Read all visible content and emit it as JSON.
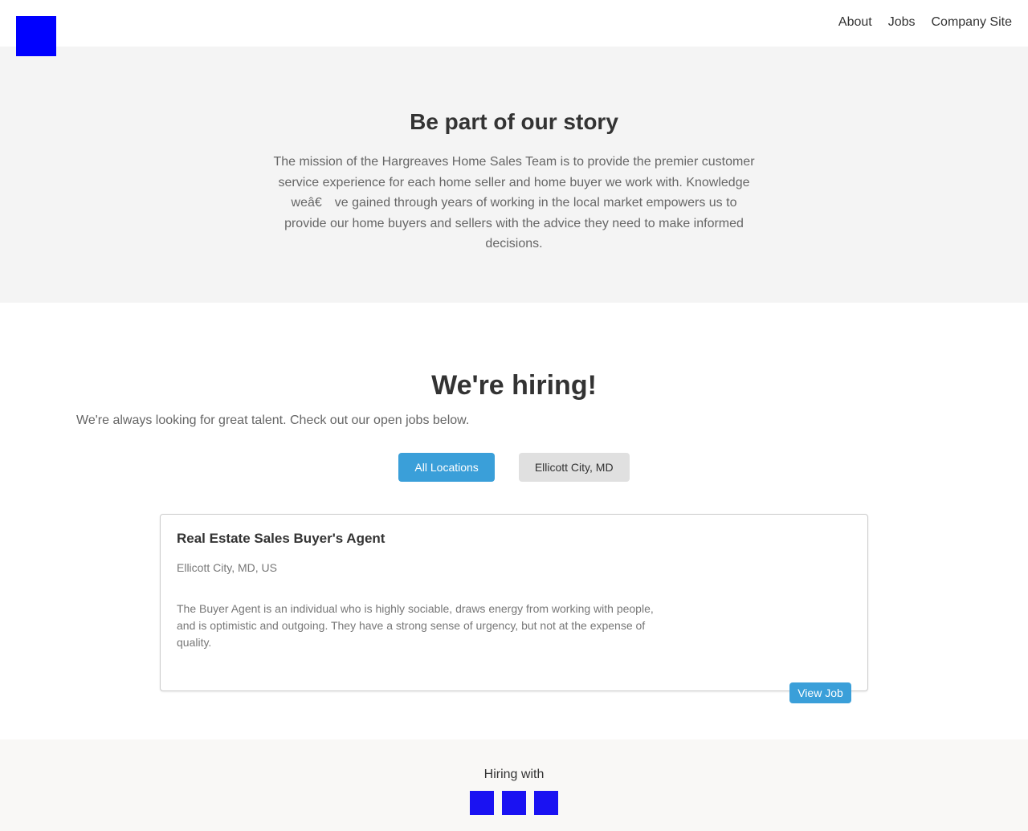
{
  "colors": {
    "logo": "#0000ff",
    "accent": "#3a9fd9",
    "hero_bg": "#f4f4f4",
    "footer_icon": "#1a12f2"
  },
  "header": {
    "nav": [
      "About",
      "Jobs",
      "Company Site"
    ]
  },
  "hero": {
    "title": "Be part of our story",
    "body": "The mission of the Hargreaves Home Sales Team is to provide the premier customer service experience for each home seller and home buyer we work with. Knowledge weâ€ ve gained through years of working in the local market empowers us to provide our home buyers and sellers with the advice they need to make informed decisions."
  },
  "hiring": {
    "title": "We're hiring!",
    "subtitle": "We're always looking for great talent. Check out our open jobs below.",
    "filters": [
      "All Locations",
      "Ellicott City, MD"
    ],
    "active_filter": "All Locations"
  },
  "job": {
    "title": "Real Estate Sales Buyer's Agent",
    "location": "Ellicott City, MD, US",
    "description": "The Buyer Agent is an individual who is highly sociable, draws energy from working with people, and is optimistic and outgoing. They have a strong sense of urgency, but not at the expense of quality.",
    "view_label": "View Job"
  },
  "footer": {
    "hiring_with": "Hiring with",
    "icons": [
      "partner-logo-icon",
      "partner-logo-icon",
      "partner-logo-icon"
    ]
  }
}
